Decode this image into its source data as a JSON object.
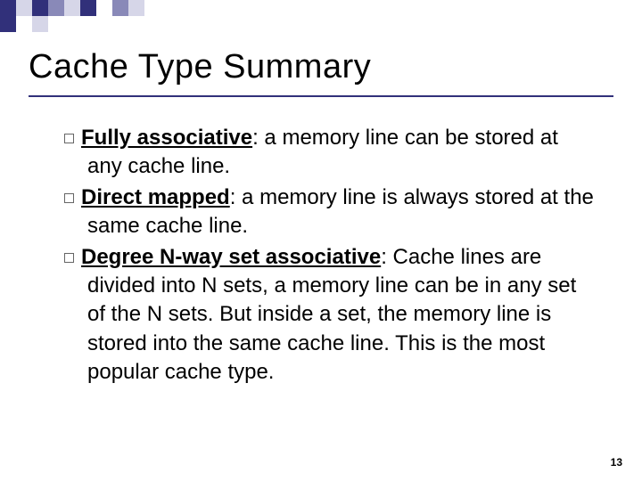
{
  "title": "Cache Type Summary",
  "items": [
    {
      "term": "Fully associative",
      "desc": ": a memory line can be stored at any cache line."
    },
    {
      "term": "Direct mapped",
      "desc": ": a memory line is always stored at the same cache line."
    },
    {
      "term": "Degree N-way set associative",
      "desc": ": Cache lines are divided into N sets, a memory line can be in any set of the N sets. But inside a set, the memory line is stored into the same cache line. This is the most popular cache type."
    }
  ],
  "page_number": "13"
}
